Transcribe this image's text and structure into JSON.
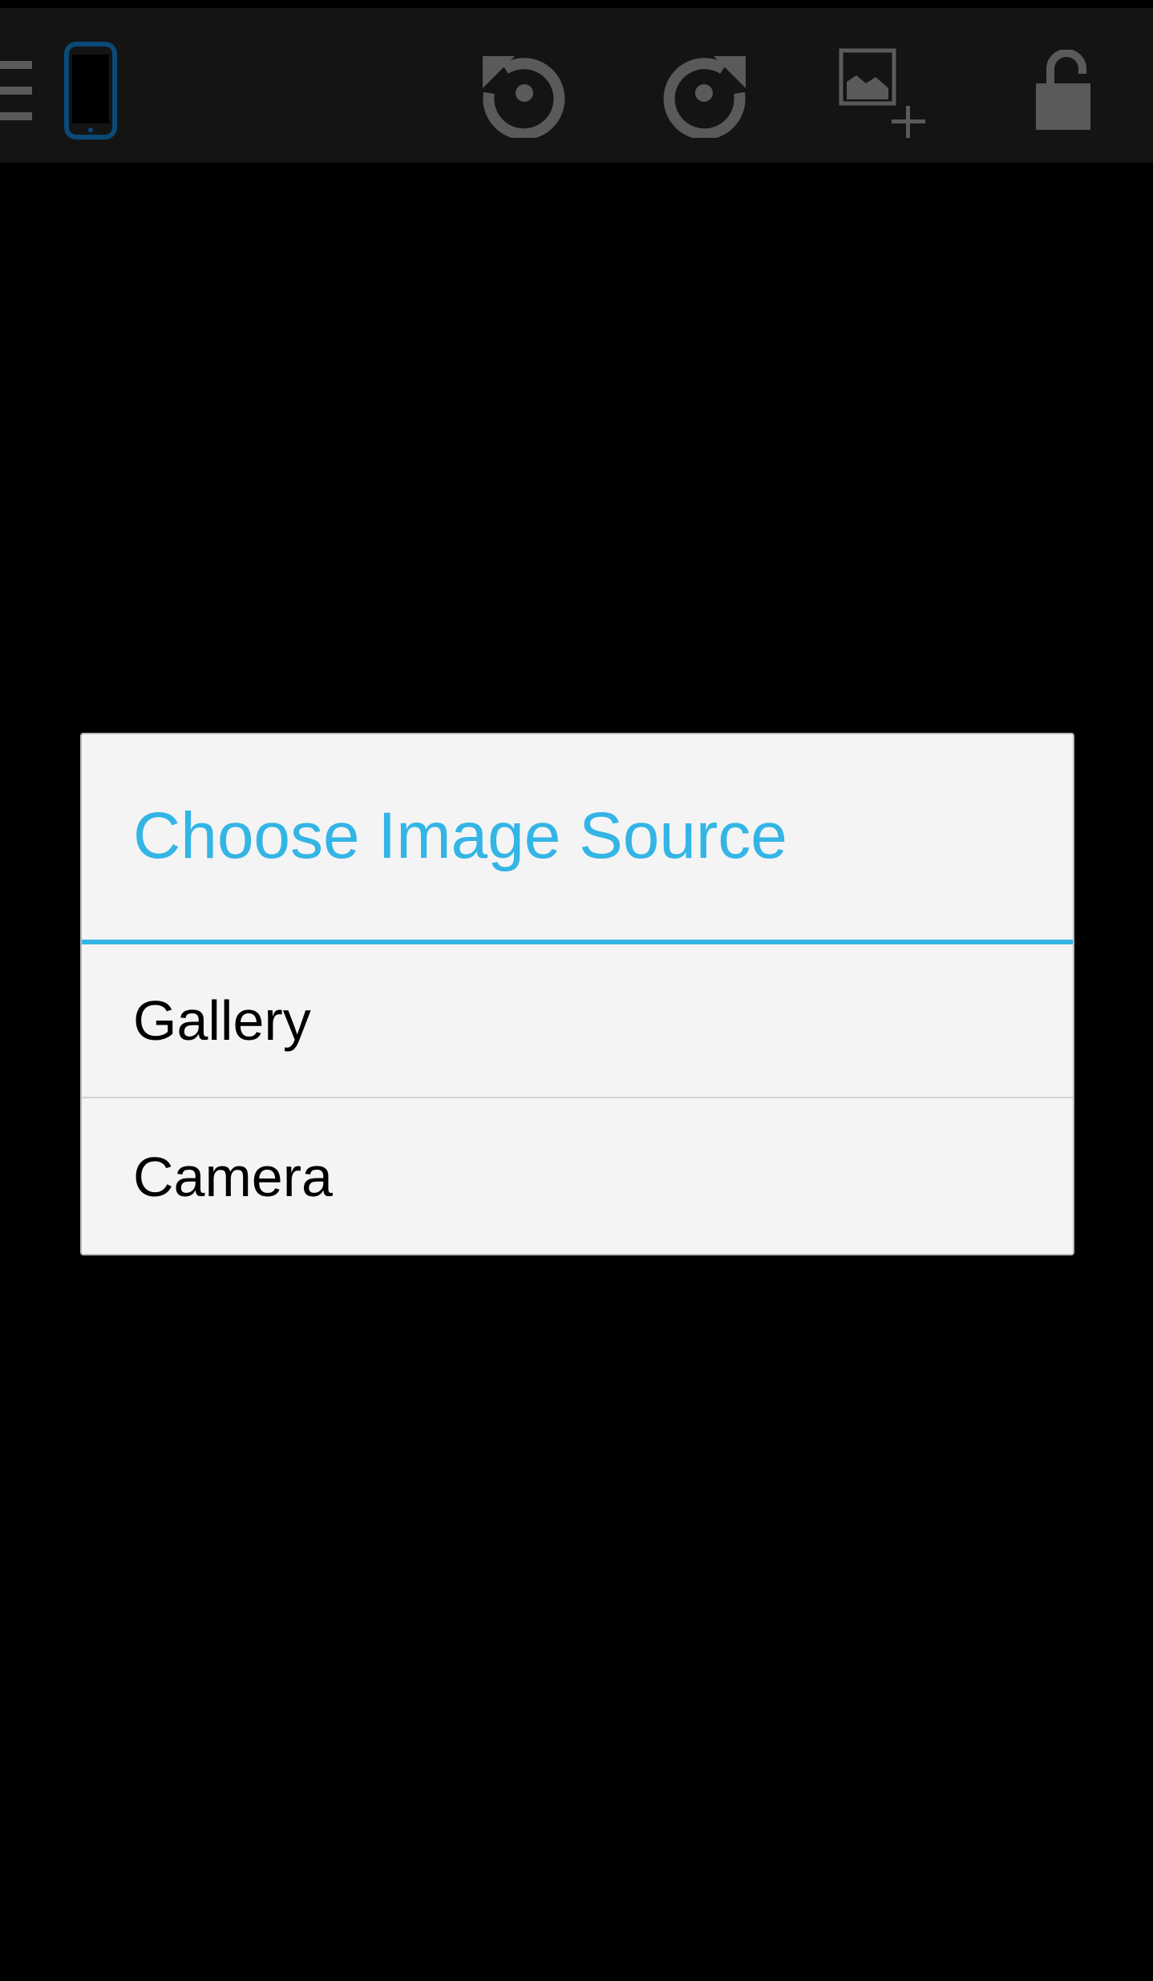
{
  "toolbar": {
    "icons": {
      "menu": "menu-icon",
      "device": "phone-icon",
      "undo": "undo-icon",
      "redo": "redo-icon",
      "add_image": "add-image-icon",
      "lock": "lock-icon"
    },
    "colors": {
      "background": "#141414",
      "icon": "#5a5a5a",
      "device_icon": "#0a4a78"
    }
  },
  "dialog": {
    "title": "Choose Image Source",
    "options": [
      {
        "label": "Gallery"
      },
      {
        "label": "Camera"
      }
    ],
    "colors": {
      "accent": "#33b5e5",
      "background": "#f4f4f4",
      "text": "#000000"
    }
  }
}
